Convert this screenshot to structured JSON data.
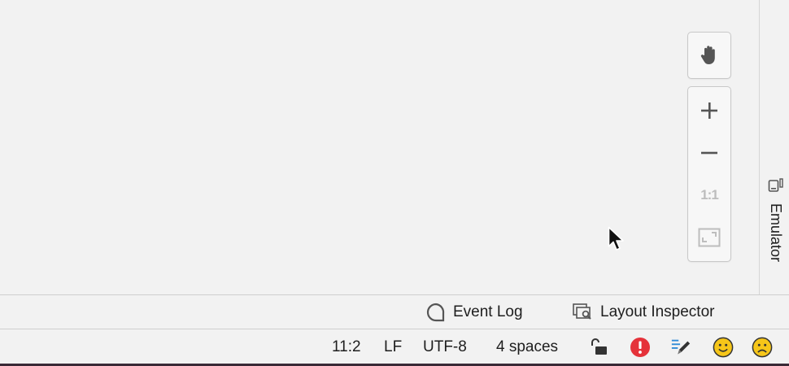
{
  "toolbar": {
    "pan_icon": "hand-icon",
    "zoom_in_icon": "plus-icon",
    "zoom_out_icon": "minus-icon",
    "actual_size_label": "1:1",
    "fit_screen_icon": "fit-screen-icon"
  },
  "side_panel": {
    "emulator_label": "Emulator",
    "emulator_icon": "device-icon"
  },
  "bottom_tabs": {
    "event_log_label": "Event Log",
    "layout_inspector_label": "Layout Inspector"
  },
  "status_bar": {
    "position": "11:2",
    "line_separator": "LF",
    "encoding": "UTF-8",
    "indent": "4 spaces",
    "icons": [
      "lock-open-icon",
      "error-icon",
      "highlighting-icon",
      "smile-icon",
      "frown-icon"
    ]
  },
  "colors": {
    "error": "#e5323a",
    "smile": "#f6c619",
    "highlight_blue": "#2d8ad6"
  }
}
